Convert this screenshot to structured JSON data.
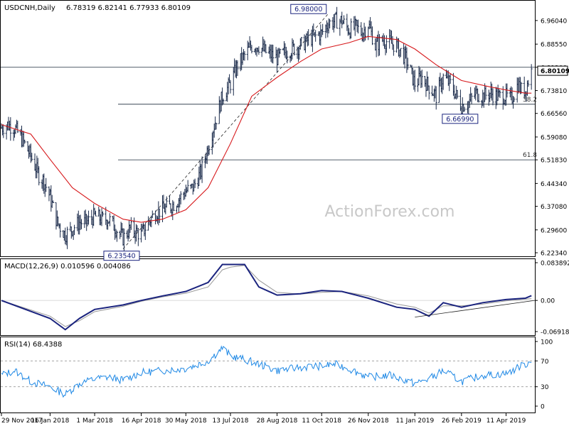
{
  "chart_data": [
    {
      "type": "ohlc",
      "title": "USDCNH,Daily",
      "ohlc_readout": [
        "6.78319",
        "6.82141",
        "6.77933",
        "6.80109"
      ],
      "current_price": "6.80109",
      "ylim": [
        6.2234,
        7.0075
      ],
      "y_ticks": [
        "6.96040",
        "6.88550",
        "6.81200",
        "6.73810",
        "6.66560",
        "6.59080",
        "6.51830",
        "6.44340",
        "6.37080",
        "6.29600",
        "6.22340"
      ],
      "y_tick_values": [
        6.9604,
        6.8855,
        6.812,
        6.7381,
        6.6656,
        6.5908,
        6.5183,
        6.4434,
        6.3708,
        6.296,
        6.2234
      ],
      "x_ticks": [
        "29 Nov 2017",
        "16 Jan 2018",
        "1 Mar 2018",
        "16 Apr 2018",
        "30 May 2018",
        "13 Jul 2018",
        "28 Aug 2018",
        "11 Oct 2018",
        "26 Nov 2018",
        "11 Jan 2019",
        "26 Feb 2019",
        "11 Apr 2019"
      ],
      "close_series": [
        [
          "29 Nov 2017",
          6.62
        ],
        [
          "5 Dec 2017",
          6.63
        ],
        [
          "12 Dec 2017",
          6.62
        ],
        [
          "20 Dec 2017",
          6.58
        ],
        [
          "28 Dec 2017",
          6.53
        ],
        [
          "5 Jan 2018",
          6.47
        ],
        [
          "10 Jan 2018",
          6.45
        ],
        [
          "16 Jan 2018",
          6.4
        ],
        [
          "23 Jan 2018",
          6.32
        ],
        [
          "31 Jan 2018",
          6.28
        ],
        [
          "7 Feb 2018",
          6.3
        ],
        [
          "14 Feb 2018",
          6.32
        ],
        [
          "21 Feb 2018",
          6.32
        ],
        [
          "1 Mar 2018",
          6.34
        ],
        [
          "8 Mar 2018",
          6.33
        ],
        [
          "15 Mar 2018",
          6.33
        ],
        [
          "22 Mar 2018",
          6.3
        ],
        [
          "29 Mar 2018",
          6.27
        ],
        [
          "5 Apr 2018",
          6.3
        ],
        [
          "16 Apr 2018",
          6.28
        ],
        [
          "23 Apr 2018",
          6.32
        ],
        [
          "30 Apr 2018",
          6.35
        ],
        [
          "7 May 2018",
          6.36
        ],
        [
          "15 May 2018",
          6.37
        ],
        [
          "22 May 2018",
          6.39
        ],
        [
          "30 May 2018",
          6.42
        ],
        [
          "6 Jun 2018",
          6.43
        ],
        [
          "14 Jun 2018",
          6.48
        ],
        [
          "21 Jun 2018",
          6.56
        ],
        [
          "28 Jun 2018",
          6.64
        ],
        [
          "5 Jul 2018",
          6.72
        ],
        [
          "13 Jul 2018",
          6.76
        ],
        [
          "20 Jul 2018",
          6.82
        ],
        [
          "27 Jul 2018",
          6.85
        ],
        [
          "3 Aug 2018",
          6.88
        ],
        [
          "10 Aug 2018",
          6.88
        ],
        [
          "17 Aug 2018",
          6.86
        ],
        [
          "28 Aug 2018",
          6.84
        ],
        [
          "5 Sep 2018",
          6.86
        ],
        [
          "12 Sep 2018",
          6.87
        ],
        [
          "20 Sep 2018",
          6.88
        ],
        [
          "28 Sep 2018",
          6.9
        ],
        [
          "11 Oct 2018",
          6.92
        ],
        [
          "17 Oct 2018",
          6.95
        ],
        [
          "24 Oct 2018",
          6.96
        ],
        [
          "31 Oct 2018",
          6.96
        ],
        [
          "7 Nov 2018",
          6.93
        ],
        [
          "14 Nov 2018",
          6.94
        ],
        [
          "20 Nov 2018",
          6.92
        ],
        [
          "26 Nov 2018",
          6.95
        ],
        [
          "3 Dec 2018",
          6.88
        ],
        [
          "10 Dec 2018",
          6.9
        ],
        [
          "17 Dec 2018",
          6.89
        ],
        [
          "24 Dec 2018",
          6.88
        ],
        [
          "2 Jan 2019",
          6.84
        ],
        [
          "11 Jan 2019",
          6.76
        ],
        [
          "18 Jan 2019",
          6.78
        ],
        [
          "25 Jan 2019",
          6.75
        ],
        [
          "1 Feb 2019",
          6.72
        ],
        [
          "8 Feb 2019",
          6.78
        ],
        [
          "15 Feb 2019",
          6.76
        ],
        [
          "26 Feb 2019",
          6.69
        ],
        [
          "5 Mar 2019",
          6.7
        ],
        [
          "12 Mar 2019",
          6.73
        ],
        [
          "19 Mar 2019",
          6.72
        ],
        [
          "26 Mar 2019",
          6.73
        ],
        [
          "2 Apr 2019",
          6.72
        ],
        [
          "11 Apr 2019",
          6.72
        ],
        [
          "16 Apr 2019",
          6.71
        ],
        [
          "19 Apr 2019",
          6.73
        ],
        [
          "23 Apr 2019",
          6.76
        ],
        [
          "26 Apr 2019",
          6.74
        ],
        [
          "30 Apr 2019",
          6.74
        ],
        [
          "6 May 2019",
          6.8
        ]
      ],
      "moving_average": [
        [
          "29 Nov 2017",
          6.63
        ],
        [
          "28 Dec 2017",
          6.6
        ],
        [
          "16 Jan 2018",
          6.52
        ],
        [
          "7 Feb 2018",
          6.43
        ],
        [
          "1 Mar 2018",
          6.38
        ],
        [
          "29 Mar 2018",
          6.33
        ],
        [
          "16 Apr 2018",
          6.32
        ],
        [
          "7 May 2018",
          6.33
        ],
        [
          "30 May 2018",
          6.36
        ],
        [
          "21 Jun 2018",
          6.43
        ],
        [
          "13 Jul 2018",
          6.57
        ],
        [
          "3 Aug 2018",
          6.72
        ],
        [
          "28 Aug 2018",
          6.78
        ],
        [
          "20 Sep 2018",
          6.83
        ],
        [
          "11 Oct 2018",
          6.87
        ],
        [
          "7 Nov 2018",
          6.89
        ],
        [
          "26 Nov 2018",
          6.91
        ],
        [
          "24 Dec 2018",
          6.9
        ],
        [
          "11 Jan 2019",
          6.87
        ],
        [
          "1 Feb 2019",
          6.82
        ],
        [
          "26 Feb 2019",
          6.77
        ],
        [
          "26 Mar 2019",
          6.75
        ],
        [
          "11 Apr 2019",
          6.74
        ],
        [
          "30 Apr 2019",
          6.73
        ],
        [
          "6 May 2019",
          6.73
        ]
      ],
      "horizontal_levels": [
        {
          "value": 6.812,
          "extent": "full"
        },
        {
          "value": 6.6947,
          "label": "38.2"
        },
        {
          "value": 6.5183,
          "label": "61.8"
        }
      ],
      "annotations": [
        {
          "text": "6.98000",
          "x": "17 Oct 2018",
          "y": 6.98
        },
        {
          "text": "6.66990",
          "x": "26 Feb 2019",
          "y": 6.6699
        },
        {
          "text": "6.23540",
          "x": "29 Mar 2018",
          "y": 6.2354
        }
      ],
      "trendline": {
        "from": [
          "29 Mar 2018",
          6.2354
        ],
        "to": [
          "17 Oct 2018",
          6.98
        ],
        "style": "dashed"
      },
      "watermark": "ActionForex.com"
    },
    {
      "type": "line",
      "title": "MACD(12,26,9) 0.010596 0.004086",
      "ylim": [
        -0.0692,
        0.0839
      ],
      "y_ticks": [
        "0.083892",
        "0.00",
        "-0.069189"
      ],
      "y_tick_values": [
        0.0839,
        0.0,
        -0.0692
      ],
      "series": [
        {
          "values": [
            [
              "29 Nov 2017",
              0.0
            ],
            [
              "16 Jan 2018",
              -0.04
            ],
            [
              "31 Jan 2018",
              -0.065
            ],
            [
              "14 Feb 2018",
              -0.04
            ],
            [
              "1 Mar 2018",
              -0.02
            ],
            [
              "29 Mar 2018",
              -0.01
            ],
            [
              "16 Apr 2018",
              0.0
            ],
            [
              "7 May 2018",
              0.01
            ],
            [
              "30 May 2018",
              0.02
            ],
            [
              "21 Jun 2018",
              0.04
            ],
            [
              "5 Jul 2018",
              0.08
            ],
            [
              "13 Jul 2018",
              0.08
            ],
            [
              "27 Jul 2018",
              0.08
            ],
            [
              "10 Aug 2018",
              0.03
            ],
            [
              "28 Aug 2018",
              0.012
            ],
            [
              "20 Sep 2018",
              0.015
            ],
            [
              "11 Oct 2018",
              0.022
            ],
            [
              "31 Oct 2018",
              0.02
            ],
            [
              "26 Nov 2018",
              0.005
            ],
            [
              "24 Dec 2018",
              -0.015
            ],
            [
              "11 Jan 2019",
              -0.02
            ],
            [
              "25 Jan 2019",
              -0.035
            ],
            [
              "8 Feb 2019",
              -0.005
            ],
            [
              "26 Feb 2019",
              -0.015
            ],
            [
              "19 Mar 2019",
              -0.005
            ],
            [
              "11 Apr 2019",
              0.002
            ],
            [
              "30 Apr 2019",
              0.005
            ],
            [
              "6 May 2019",
              0.0106
            ]
          ]
        },
        {
          "values": [
            [
              "29 Nov 2017",
              0.0
            ],
            [
              "16 Jan 2018",
              -0.035
            ],
            [
              "31 Jan 2018",
              -0.058
            ],
            [
              "14 Feb 2018",
              -0.045
            ],
            [
              "1 Mar 2018",
              -0.025
            ],
            [
              "29 Mar 2018",
              -0.013
            ],
            [
              "16 Apr 2018",
              -0.002
            ],
            [
              "7 May 2018",
              0.008
            ],
            [
              "30 May 2018",
              0.016
            ],
            [
              "21 Jun 2018",
              0.03
            ],
            [
              "5 Jul 2018",
              0.068
            ],
            [
              "13 Jul 2018",
              0.074
            ],
            [
              "27 Jul 2018",
              0.078
            ],
            [
              "10 Aug 2018",
              0.045
            ],
            [
              "28 Aug 2018",
              0.018
            ],
            [
              "20 Sep 2018",
              0.014
            ],
            [
              "11 Oct 2018",
              0.018
            ],
            [
              "31 Oct 2018",
              0.02
            ],
            [
              "26 Nov 2018",
              0.01
            ],
            [
              "24 Dec 2018",
              -0.008
            ],
            [
              "11 Jan 2019",
              -0.015
            ],
            [
              "25 Jan 2019",
              -0.028
            ],
            [
              "8 Feb 2019",
              -0.012
            ],
            [
              "26 Feb 2019",
              -0.012
            ],
            [
              "19 Mar 2019",
              -0.008
            ],
            [
              "11 Apr 2019",
              -0.001
            ],
            [
              "30 Apr 2019",
              0.003
            ],
            [
              "6 May 2019",
              0.0041
            ]
          ]
        }
      ],
      "trendline": {
        "from": [
          "11 Jan 2019",
          -0.037
        ],
        "to": [
          "6 May 2019",
          0.0
        ]
      }
    },
    {
      "type": "line",
      "title": "RSI(14) 68.4388",
      "ylim": [
        0,
        100
      ],
      "y_ticks": [
        "100",
        "70",
        "30",
        "0"
      ],
      "y_tick_values": [
        100,
        70,
        30,
        0
      ],
      "reference_levels": [
        70,
        30
      ],
      "series": [
        {
          "values": [
            [
              "29 Nov 2017",
              48
            ],
            [
              "12 Dec 2017",
              55
            ],
            [
              "28 Dec 2017",
              38
            ],
            [
              "16 Jan 2018",
              30
            ],
            [
              "31 Jan 2018",
              18
            ],
            [
              "14 Feb 2018",
              35
            ],
            [
              "1 Mar 2018",
              42
            ],
            [
              "15 Mar 2018",
              45
            ],
            [
              "29 Mar 2018",
              40
            ],
            [
              "16 Apr 2018",
              52
            ],
            [
              "7 May 2018",
              55
            ],
            [
              "30 May 2018",
              58
            ],
            [
              "21 Jun 2018",
              70
            ],
            [
              "5 Jul 2018",
              90
            ],
            [
              "13 Jul 2018",
              78
            ],
            [
              "27 Jul 2018",
              72
            ],
            [
              "10 Aug 2018",
              65
            ],
            [
              "28 Aug 2018",
              55
            ],
            [
              "20 Sep 2018",
              60
            ],
            [
              "11 Oct 2018",
              62
            ],
            [
              "24 Oct 2018",
              65
            ],
            [
              "7 Nov 2018",
              58
            ],
            [
              "26 Nov 2018",
              45
            ],
            [
              "17 Dec 2018",
              48
            ],
            [
              "11 Jan 2019",
              35
            ],
            [
              "25 Jan 2019",
              42
            ],
            [
              "8 Feb 2019",
              55
            ],
            [
              "26 Feb 2019",
              38
            ],
            [
              "19 Mar 2019",
              48
            ],
            [
              "11 Apr 2019",
              50
            ],
            [
              "23 Apr 2019",
              60
            ],
            [
              "6 May 2019",
              68.4
            ]
          ]
        }
      ]
    }
  ]
}
